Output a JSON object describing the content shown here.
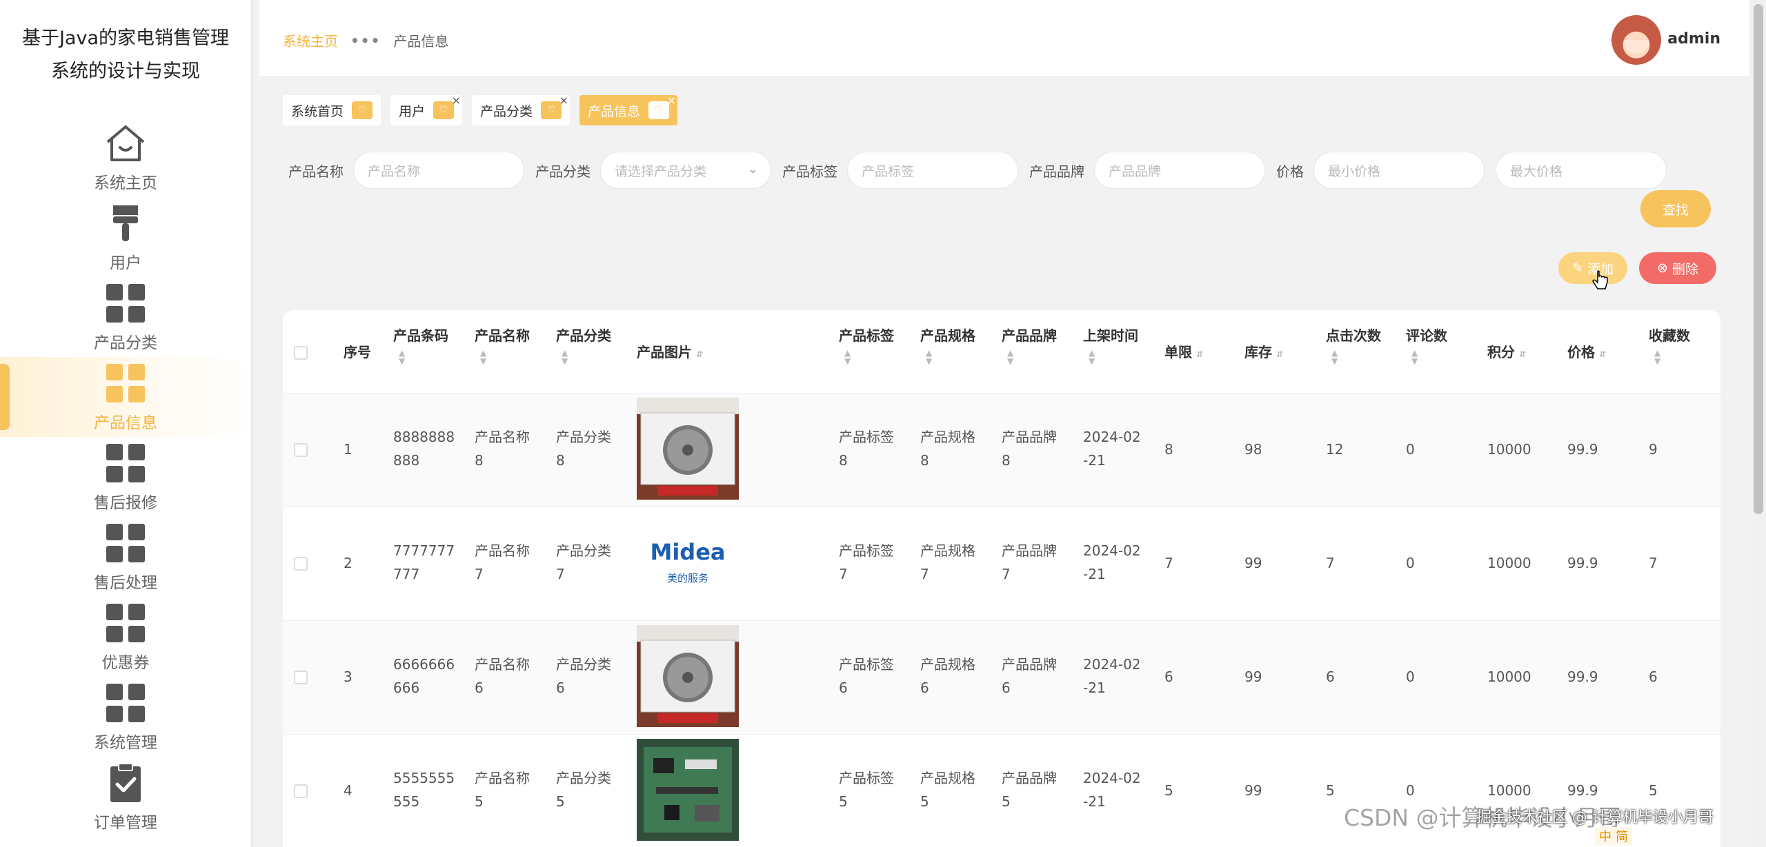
{
  "app": {
    "title_line1": "基于Java的家电销售管理",
    "title_line2": "系统的设计与实现"
  },
  "sidebar": {
    "items": [
      {
        "label": "系统主页",
        "icon": "home-icon"
      },
      {
        "label": "用户",
        "icon": "brush-icon"
      },
      {
        "label": "产品分类",
        "icon": "grid-icon"
      },
      {
        "label": "产品信息",
        "icon": "grid-icon",
        "active": true
      },
      {
        "label": "售后报修",
        "icon": "grid-icon"
      },
      {
        "label": "售后处理",
        "icon": "grid-icon"
      },
      {
        "label": "优惠券",
        "icon": "grid-icon"
      },
      {
        "label": "系统管理",
        "icon": "grid-icon"
      },
      {
        "label": "订单管理",
        "icon": "clipboard-check-icon"
      }
    ]
  },
  "header": {
    "breadcrumb_home": "系统主页",
    "breadcrumb_sep": "•••",
    "breadcrumb_current": "产品信息",
    "username": "admin"
  },
  "tags": [
    {
      "label": "系统首页",
      "closable": false
    },
    {
      "label": "用户",
      "closable": true
    },
    {
      "label": "产品分类",
      "closable": true
    },
    {
      "label": "产品信息",
      "closable": true,
      "active": true
    }
  ],
  "tag_close_glyph": "×",
  "search": {
    "name_label": "产品名称",
    "name_placeholder": "产品名称",
    "category_label": "产品分类",
    "category_placeholder": "请选择产品分类",
    "tag_label": "产品标签",
    "tag_placeholder": "产品标签",
    "brand_label": "产品品牌",
    "brand_placeholder": "产品品牌",
    "price_label": "价格",
    "min_price_placeholder": "最小价格",
    "max_price_placeholder": "最大价格",
    "search_button": "查找"
  },
  "actions": {
    "add_button": "添加",
    "delete_button": "删除"
  },
  "table": {
    "headers": {
      "index": "序号",
      "barcode": "产品条码",
      "name": "产品名称",
      "category": "产品分类",
      "image": "产品图片",
      "tag": "产品标签",
      "spec": "产品规格",
      "brand": "产品品牌",
      "shelf_time": "上架时间",
      "limit": "单限",
      "stock": "库存",
      "clicks": "点击次数",
      "comments": "评论数",
      "points": "积分",
      "price": "价格",
      "favorites": "收藏数"
    },
    "rows": [
      {
        "index": "1",
        "barcode_1": "8888888",
        "barcode_2": "888",
        "name_1": "产品名称",
        "name_2": "8",
        "category_1": "产品分类",
        "category_2": "8",
        "image": "air-conditioner",
        "tag_1": "产品标签",
        "tag_2": "8",
        "spec_1": "产品规格",
        "spec_2": "8",
        "brand_1": "产品品牌",
        "brand_2": "8",
        "time_1": "2024-02",
        "time_2": "-21",
        "limit": "8",
        "stock": "98",
        "clicks": "12",
        "comments": "0",
        "points": "10000",
        "price": "99.9",
        "favorites": "9"
      },
      {
        "index": "2",
        "barcode_1": "7777777",
        "barcode_2": "777",
        "name_1": "产品名称",
        "name_2": "7",
        "category_1": "产品分类",
        "category_2": "7",
        "image": "midea-logo",
        "tag_1": "产品标签",
        "tag_2": "7",
        "spec_1": "产品规格",
        "spec_2": "7",
        "brand_1": "产品品牌",
        "brand_2": "7",
        "time_1": "2024-02",
        "time_2": "-21",
        "limit": "7",
        "stock": "99",
        "clicks": "7",
        "comments": "0",
        "points": "10000",
        "price": "99.9",
        "favorites": "7"
      },
      {
        "index": "3",
        "barcode_1": "6666666",
        "barcode_2": "666",
        "name_1": "产品名称",
        "name_2": "6",
        "category_1": "产品分类",
        "category_2": "6",
        "image": "air-conditioner",
        "tag_1": "产品标签",
        "tag_2": "6",
        "spec_1": "产品规格",
        "spec_2": "6",
        "brand_1": "产品品牌",
        "brand_2": "6",
        "time_1": "2024-02",
        "time_2": "-21",
        "limit": "6",
        "stock": "99",
        "clicks": "6",
        "comments": "0",
        "points": "10000",
        "price": "99.9",
        "favorites": "6"
      },
      {
        "index": "4",
        "barcode_1": "5555555",
        "barcode_2": "555",
        "name_1": "产品名称",
        "name_2": "5",
        "category_1": "产品分类",
        "category_2": "5",
        "image": "circuit-board",
        "tag_1": "产品标签",
        "tag_2": "5",
        "spec_1": "产品规格",
        "spec_2": "5",
        "brand_1": "产品品牌",
        "brand_2": "5",
        "time_1": "2024-02",
        "time_2": "-21",
        "limit": "5",
        "stock": "99",
        "clicks": "5",
        "comments": "0",
        "points": "10000",
        "price": "99.9",
        "favorites": "5"
      }
    ]
  },
  "images": {
    "midea_text": "Midea",
    "midea_sub": "美的服务"
  },
  "watermark": {
    "csdn": "CSDN @计算机毕设小月哥",
    "juejin": "掘金技术社区 @ 计算机毕设小月哥"
  },
  "ime": {
    "mode": "中",
    "label": "简"
  },
  "colors": {
    "accent": "#f7c35c",
    "danger": "#f26b66",
    "add": "#fcd47f"
  }
}
